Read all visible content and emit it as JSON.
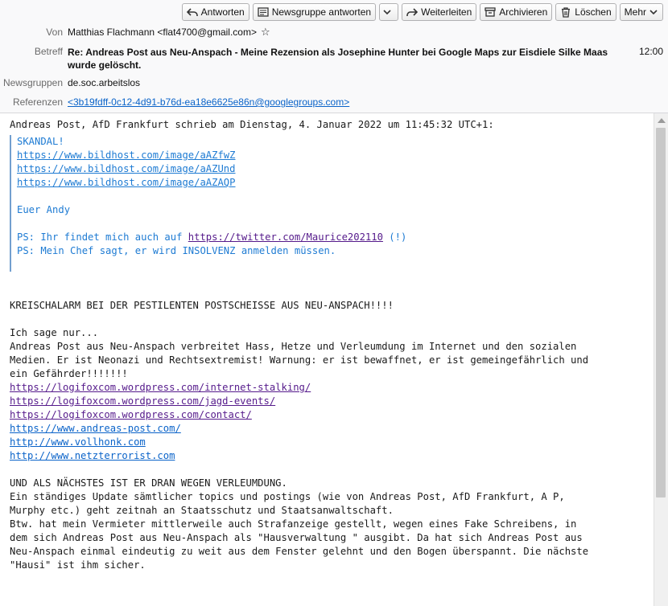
{
  "toolbar": {
    "reply": "Antworten",
    "reply_group": "Newsgruppe antworten",
    "forward": "Weiterleiten",
    "archive": "Archivieren",
    "delete": "Löschen",
    "more": "Mehr"
  },
  "header": {
    "from_label": "Von",
    "from_value": "Matthias Flachmann <flat4700@gmail.com>",
    "subject_label": "Betreff",
    "subject_value": "Re: Andreas Post aus Neu-Anspach - Meine Rezension als Josephine Hunter bei Google Maps zur Eisdiele Silke Maas wurde gelöscht.",
    "time": "12:00",
    "newsgroups_label": "Newsgruppen",
    "newsgroups_value": "de.soc.arbeitslos",
    "references_label": "Referenzen",
    "references_value": "<3b19fdff-0c12-4d91-b76d-ea18e6625e86n@googlegroups.com>"
  },
  "body": {
    "attribution": "Andreas Post, AfD Frankfurt schrieb am Dienstag, 4. Januar 2022 um 11:45:32 UTC+1:",
    "quote": {
      "line1": "SKANDAL!",
      "link1": "https://www.bildhost.com/image/aAZfwZ",
      "link2": "https://www.bildhost.com/image/aAZUnd",
      "link3": "https://www.bildhost.com/image/aAZAQP",
      "sign": "Euer Andy",
      "ps1_prefix": "PS: Ihr findet mich auch auf ",
      "ps1_link": "https://twitter.com/Maurice202110",
      "ps1_suffix": " (!)",
      "ps2": "PS: Mein Chef sagt, er wird INSOLVENZ anmelden müssen."
    },
    "alarm": "KREISCHALARM BEI DER PESTILENTEN POSTSCHEISSE AUS NEU-ANSPACH!!!!",
    "say": "Ich sage nur...",
    "p1_l1": "Andreas Post aus Neu-Anspach verbreitet Hass, Hetze und Verleumdung im Internet und den sozialen",
    "p1_l2": "Medien. Er ist Neonazi und Rechtsextremist! Warnung: er ist bewaffnet, er ist gemeingefährlich und",
    "p1_l3": "ein Gefährder!!!!!!!",
    "links": [
      "https://logifoxcom.wordpress.com/internet-stalking/",
      "https://logifoxcom.wordpress.com/jagd-events/",
      "https://logifoxcom.wordpress.com/contact/",
      "https://www.andreas-post.com/",
      "http://www.vollhonk.com",
      "http://www.netzterrorist.com"
    ],
    "p2_l1": "UND ALS NÄCHSTES IST ER DRAN WEGEN VERLEUMDUNG.",
    "p2_l2": "Ein ständiges Update sämtlicher topics und postings (wie von Andreas Post, AfD Frankfurt, A P,",
    "p2_l3": "Murphy etc.) geht zeitnah an Staatsschutz und Staatsanwaltschaft.",
    "p2_l4": "Btw. hat mein Vermieter mittlerweile auch Strafanzeige gestellt, wegen eines Fake Schreibens, in",
    "p2_l5": "dem sich Andreas Post aus Neu-Anspach als \"Hausverwaltung \" ausgibt. Da hat sich Andreas Post aus",
    "p2_l6": "Neu-Anspach einmal eindeutig zu weit aus dem Fenster gelehnt und den Bogen überspannt. Die nächste",
    "p2_l7": "\"Hausi\" ist ihm sicher."
  }
}
